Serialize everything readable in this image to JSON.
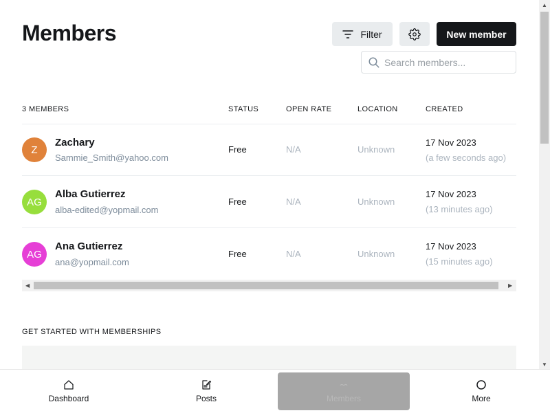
{
  "header": {
    "title": "Members",
    "filter_label": "Filter",
    "new_member_label": "New member",
    "search_placeholder": "Search members..."
  },
  "table": {
    "columns": [
      "3 MEMBERS",
      "STATUS",
      "OPEN RATE",
      "LOCATION",
      "CREATED"
    ],
    "rows": [
      {
        "initials": "Z",
        "avatar_color": "#e0823a",
        "name": "Zachary",
        "email": "Sammie_Smith@yahoo.com",
        "status": "Free",
        "open_rate": "N/A",
        "location": "Unknown",
        "created": "17 Nov 2023",
        "created_ago": "(a few seconds ago)"
      },
      {
        "initials": "AG",
        "avatar_color": "#97de3c",
        "name": "Alba Gutierrez",
        "email": "alba-edited@yopmail.com",
        "status": "Free",
        "open_rate": "N/A",
        "location": "Unknown",
        "created": "17 Nov 2023",
        "created_ago": "(13 minutes ago)"
      },
      {
        "initials": "AG",
        "avatar_color": "#e63fd6",
        "name": "Ana Gutierrez",
        "email": "ana@yopmail.com",
        "status": "Free",
        "open_rate": "N/A",
        "location": "Unknown",
        "created": "17 Nov 2023",
        "created_ago": "(15 minutes ago)"
      }
    ]
  },
  "section": {
    "title": "GET STARTED WITH MEMBERSHIPS"
  },
  "bottom_nav": [
    {
      "label": "Dashboard",
      "icon": "home-icon"
    },
    {
      "label": "Posts",
      "icon": "edit-icon"
    },
    {
      "label": "Members",
      "icon": "members-icon"
    },
    {
      "label": "More",
      "icon": "circle-icon"
    }
  ]
}
